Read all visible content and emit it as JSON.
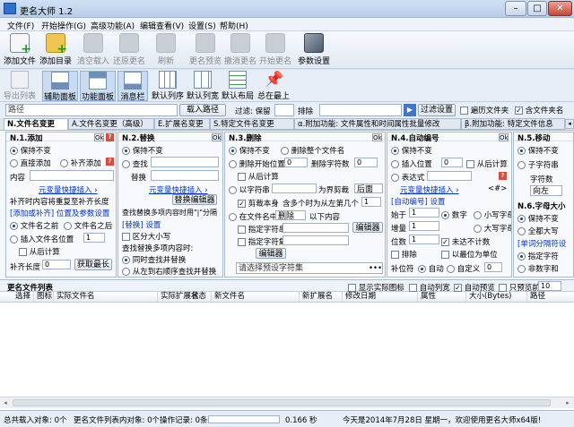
{
  "window": {
    "title": "更名大师 1.2",
    "min": "–",
    "max": "□",
    "close": "✕"
  },
  "menu": [
    "文件(F)",
    "开始操作(G)",
    "高级功能(A)",
    "编辑查看(V)",
    "设置(S)",
    "帮助(H)"
  ],
  "toolbar": [
    {
      "label": "添加文件",
      "icon": "add-file-icon",
      "enabled": true
    },
    {
      "label": "添加目录",
      "icon": "add-folder-icon",
      "enabled": true
    },
    {
      "label": "清空载入",
      "icon": "clear-icon",
      "enabled": false
    },
    {
      "label": "还原更名",
      "icon": "undo-icon",
      "enabled": false
    },
    {
      "label": "刷新",
      "icon": "refresh-icon",
      "enabled": false
    },
    {
      "label": "更名预览",
      "icon": "preview-icon",
      "enabled": false
    },
    {
      "label": "撤消更名",
      "icon": "trash-icon",
      "enabled": false
    },
    {
      "label": "开始更名",
      "icon": "check-icon",
      "enabled": false
    },
    {
      "label": "参数设置",
      "icon": "tools-icon",
      "enabled": true
    }
  ],
  "toolbar2": [
    {
      "label": "导出列表",
      "icon": "export-icon",
      "on": false
    },
    {
      "label": "辅助面板",
      "icon": "panel-icon",
      "on": true
    },
    {
      "label": "功能面板",
      "icon": "function-panel-icon",
      "on": true
    },
    {
      "label": "消息栏",
      "icon": "message-icon",
      "on": true
    },
    {
      "label": "默认列序",
      "icon": "column-order-icon",
      "on": false
    },
    {
      "label": "默认列宽",
      "icon": "column-width-icon",
      "on": false
    },
    {
      "label": "默认布局",
      "icon": "layout-icon",
      "on": false
    },
    {
      "label": "总在最上",
      "icon": "pin-icon",
      "on": false
    }
  ],
  "pathrow": {
    "path_label": "路径",
    "load_path": "载入路径",
    "filter_label": "过滤: 保留",
    "exclude": "排除",
    "filter_settings": "过滤设置",
    "subfolders": "遍历文件夹",
    "include_folder": "含文件夹名"
  },
  "tabs": [
    "N.文件名变更",
    "A.文件名变更（高级）",
    "E.扩展名变更",
    "S.特定文件名变更",
    "α.附加功能: 文件属性和时间属性批量修改",
    "β.附加功能: 特定文件信息"
  ],
  "g1": {
    "title": "N.1.添加",
    "keep": "保持不变",
    "direct": "直接添加",
    "supp": "补齐添加",
    "content": "内容",
    "quick": "元变量快捷插入 ›",
    "note": "补齐时内容将重复至补齐长度",
    "mode_title": "[添加或补齐] 位置及参数设置",
    "before": "文件名之前",
    "after": "文件名之后",
    "insert": "插入文件名位置",
    "insert_val": "1",
    "from_tail": "从后计算",
    "pad_len": "补齐长度",
    "pad_val": "0",
    "get_max": "获取最长"
  },
  "g2": {
    "title": "N.2.替换",
    "keep": "保持不变",
    "find": "查找",
    "replace": "替换",
    "quick": "元变量快捷插入 ›",
    "replace_editor": "替换编辑器",
    "multi": "查找替换多项内容时用\"|\"分隔",
    "set_title": "[替换] 设置",
    "case": "区分大小写",
    "multi2": "查找替换多项内容时:",
    "sync": "同时查找并替换",
    "l2r": "从左到右顺序查找并替换"
  },
  "g3": {
    "title": "N.3.删除",
    "keep": "保持不变",
    "del_whole": "删除整个文件名",
    "del_start": "删除开始位置",
    "start_val": "0",
    "del_chars": "删除字符数",
    "chars_val": "0",
    "from_tail": "从后计算",
    "by_str": "以字符串",
    "boundary": "为界剪裁",
    "after": "后面",
    "cut_self": "剪裁本身",
    "repeat": "含多个时为从左第几个",
    "repeat_val": "1",
    "in_name": "在文件名中",
    "del": "删除",
    "below": "以下内容",
    "spec_char": "指定字符串",
    "editor": "编辑器",
    "spec_set": "指定字符集",
    "editor2": "编辑器",
    "hint": "请选择预设字符集",
    "ellipsis": "•••"
  },
  "g4": {
    "title": "N.4.自动编号",
    "keep": "保持不变",
    "insert": "插入位置",
    "insert_val": "0",
    "from_tail": "从后计算",
    "expr": "表达式",
    "quick": "元变量快捷插入 ›",
    "brackets": "<#>",
    "set_title": "[自动编号] 设置",
    "start": "始于",
    "start_val": "1",
    "number": "数字",
    "lower": "小写字母",
    "step": "增量",
    "step_val": "1",
    "upper": "大写字母",
    "digits": "位数",
    "digits_val": "1",
    "no_fill": "未达不计数",
    "min_unit": "以最位为单位",
    "sort": "排除",
    "pad": "补位符",
    "auto": "自动",
    "custom": "自定义",
    "custom_val": "0"
  },
  "g5": {
    "title": "N.5.移动",
    "keep": "保持不变",
    "sub": "子字符串",
    "chars": "字符数",
    "left": "向左",
    "case_title": "N.6.字母大小",
    "keep2": "保持不变",
    "all_upper": "全都大写",
    "case_set": "[单词分隔符设",
    "spec": "指定字符",
    "nonalpha": "非数字和"
  },
  "list": {
    "title": "更名文件列表",
    "show_icons": "显示实际图标",
    "auto_width": "自动列宽",
    "auto_preview": "自动预览",
    "preview_only": "只预览前",
    "preview_n": "10"
  },
  "columns": [
    "选择",
    "图标",
    "实际文件名",
    "实际扩展名",
    "状态",
    "新文件名",
    "新扩展名",
    "修改日期",
    "属性",
    "大小(Bytes)",
    "路径"
  ],
  "status": {
    "loaded": "总共载入对象: 0个",
    "listed": "更名文件列表内对象: 0个",
    "ops": "操作记录: 0条",
    "time": "0.166 秒",
    "today": "今天是2014年7月28日 星期一，欢迎使用更名大师x64版!"
  }
}
